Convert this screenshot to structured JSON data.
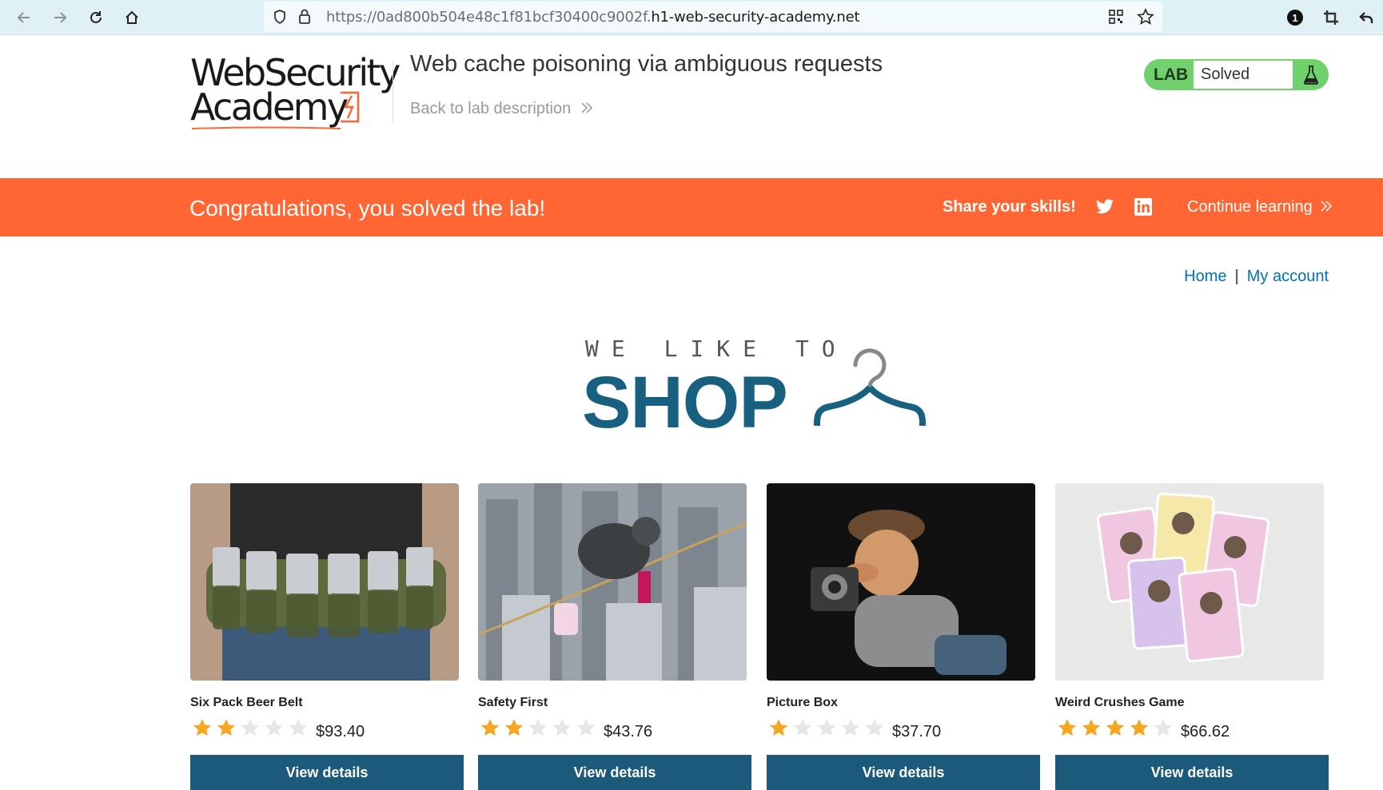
{
  "browser": {
    "url_prefix": "https://0ad800b504e48c1f81bcf30400c9002f.",
    "url_host": "h1-web-security-academy.net"
  },
  "header": {
    "logo_line1": "WebSecurity",
    "logo_line2": "Academy",
    "lab_title": "Web cache poisoning via ambiguous requests",
    "back_link": "Back to lab description",
    "lab_label": "LAB",
    "lab_status": "Solved"
  },
  "banner": {
    "message": "Congratulations, you solved the lab!",
    "share": "Share your skills!",
    "continue": "Continue learning"
  },
  "nav": {
    "home": "Home",
    "separator": "|",
    "account": "My account"
  },
  "hero": {
    "small": "WE LIKE TO",
    "big": "SHOP"
  },
  "colors": {
    "accent": "#ff6633",
    "brand_blue": "#17607f",
    "button": "#1b5a7a",
    "lab_green": "#70d16d",
    "star": "#f5a623"
  },
  "products": [
    {
      "name": "Six Pack Beer Belt",
      "rating": 2,
      "max_rating": 5,
      "price": "$93.40",
      "button": "View details"
    },
    {
      "name": "Safety First",
      "rating": 2,
      "max_rating": 5,
      "price": "$43.76",
      "button": "View details"
    },
    {
      "name": "Picture Box",
      "rating": 1,
      "max_rating": 5,
      "price": "$37.70",
      "button": "View details"
    },
    {
      "name": "Weird Crushes Game",
      "rating": 4,
      "max_rating": 5,
      "price": "$66.62",
      "button": "View details"
    }
  ]
}
